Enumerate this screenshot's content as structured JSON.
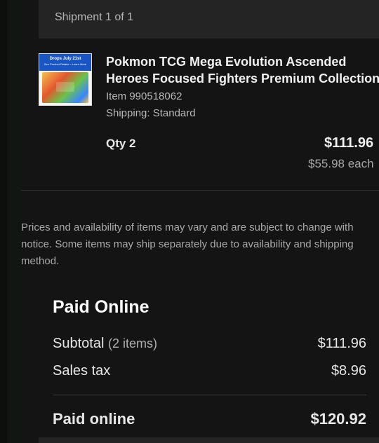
{
  "shipment": {
    "label": "Shipment 1 of 1"
  },
  "item": {
    "thumbnail_banner": "Drops July 21st",
    "thumbnail_subtext": "See Product Details > Learn More",
    "title_line1": "Pokmon TCG Mega Evolution Ascended",
    "title_line2": "Heroes Focused Fighters Premium Collection",
    "item_number": "Item 990518062",
    "shipping": "Shipping: Standard",
    "qty": "Qty 2",
    "price_total": "$111.96",
    "price_each": "$55.98 each"
  },
  "notice": {
    "line1": "Prices and availability of items may vary and are subject to change with",
    "line2": "notice. Some items may ship separately due to availability and shipping",
    "line3": "method."
  },
  "summary": {
    "heading": "Paid Online",
    "subtotal_label": "Subtotal",
    "subtotal_items": "(2 items)",
    "subtotal_value": "$111.96",
    "tax_label": "Sales tax",
    "tax_value": "$8.96",
    "total_label": "Paid online",
    "total_value": "$120.92"
  }
}
